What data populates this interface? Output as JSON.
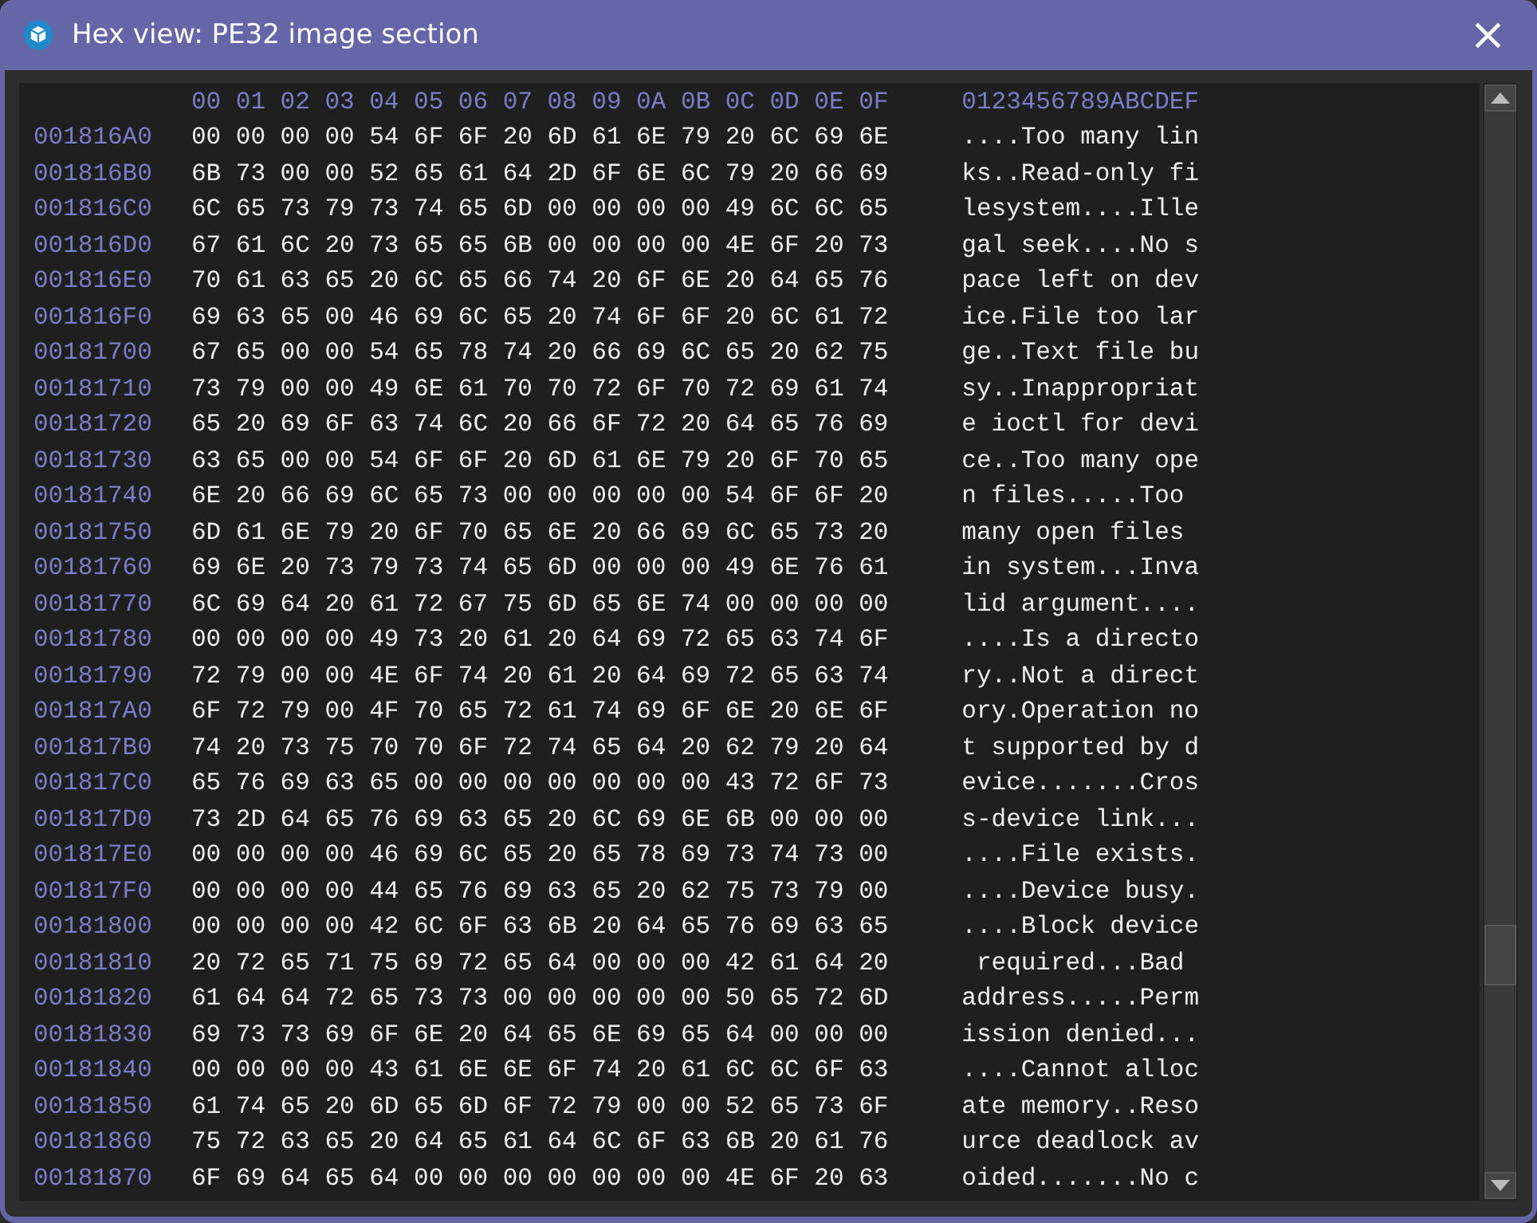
{
  "window": {
    "title": "Hex view: PE32 image section",
    "close": "×"
  },
  "header": {
    "offsets": "00 01 02 03 04 05 06 07 08 09 0A 0B 0C 0D 0E 0F",
    "ascii": "0123456789ABCDEF"
  },
  "rows": [
    {
      "address": "001816A0",
      "bytes": "00 00 00 00 54 6F 6F 20 6D 61 6E 79 20 6C 69 6E",
      "ascii": "....Too many lin"
    },
    {
      "address": "001816B0",
      "bytes": "6B 73 00 00 52 65 61 64 2D 6F 6E 6C 79 20 66 69",
      "ascii": "ks..Read-only fi"
    },
    {
      "address": "001816C0",
      "bytes": "6C 65 73 79 73 74 65 6D 00 00 00 00 49 6C 6C 65",
      "ascii": "lesystem....Ille"
    },
    {
      "address": "001816D0",
      "bytes": "67 61 6C 20 73 65 65 6B 00 00 00 00 4E 6F 20 73",
      "ascii": "gal seek....No s"
    },
    {
      "address": "001816E0",
      "bytes": "70 61 63 65 20 6C 65 66 74 20 6F 6E 20 64 65 76",
      "ascii": "pace left on dev"
    },
    {
      "address": "001816F0",
      "bytes": "69 63 65 00 46 69 6C 65 20 74 6F 6F 20 6C 61 72",
      "ascii": "ice.File too lar"
    },
    {
      "address": "00181700",
      "bytes": "67 65 00 00 54 65 78 74 20 66 69 6C 65 20 62 75",
      "ascii": "ge..Text file bu"
    },
    {
      "address": "00181710",
      "bytes": "73 79 00 00 49 6E 61 70 70 72 6F 70 72 69 61 74",
      "ascii": "sy..Inappropriat"
    },
    {
      "address": "00181720",
      "bytes": "65 20 69 6F 63 74 6C 20 66 6F 72 20 64 65 76 69",
      "ascii": "e ioctl for devi"
    },
    {
      "address": "00181730",
      "bytes": "63 65 00 00 54 6F 6F 20 6D 61 6E 79 20 6F 70 65",
      "ascii": "ce..Too many ope"
    },
    {
      "address": "00181740",
      "bytes": "6E 20 66 69 6C 65 73 00 00 00 00 00 54 6F 6F 20",
      "ascii": "n files.....Too "
    },
    {
      "address": "00181750",
      "bytes": "6D 61 6E 79 20 6F 70 65 6E 20 66 69 6C 65 73 20",
      "ascii": "many open files "
    },
    {
      "address": "00181760",
      "bytes": "69 6E 20 73 79 73 74 65 6D 00 00 00 49 6E 76 61",
      "ascii": "in system...Inva"
    },
    {
      "address": "00181770",
      "bytes": "6C 69 64 20 61 72 67 75 6D 65 6E 74 00 00 00 00",
      "ascii": "lid argument...."
    },
    {
      "address": "00181780",
      "bytes": "00 00 00 00 49 73 20 61 20 64 69 72 65 63 74 6F",
      "ascii": "....Is a directo"
    },
    {
      "address": "00181790",
      "bytes": "72 79 00 00 4E 6F 74 20 61 20 64 69 72 65 63 74",
      "ascii": "ry..Not a direct"
    },
    {
      "address": "001817A0",
      "bytes": "6F 72 79 00 4F 70 65 72 61 74 69 6F 6E 20 6E 6F",
      "ascii": "ory.Operation no"
    },
    {
      "address": "001817B0",
      "bytes": "74 20 73 75 70 70 6F 72 74 65 64 20 62 79 20 64",
      "ascii": "t supported by d"
    },
    {
      "address": "001817C0",
      "bytes": "65 76 69 63 65 00 00 00 00 00 00 00 43 72 6F 73",
      "ascii": "evice.......Cros"
    },
    {
      "address": "001817D0",
      "bytes": "73 2D 64 65 76 69 63 65 20 6C 69 6E 6B 00 00 00",
      "ascii": "s-device link..."
    },
    {
      "address": "001817E0",
      "bytes": "00 00 00 00 46 69 6C 65 20 65 78 69 73 74 73 00",
      "ascii": "....File exists."
    },
    {
      "address": "001817F0",
      "bytes": "00 00 00 00 44 65 76 69 63 65 20 62 75 73 79 00",
      "ascii": "....Device busy."
    },
    {
      "address": "00181800",
      "bytes": "00 00 00 00 42 6C 6F 63 6B 20 64 65 76 69 63 65",
      "ascii": "....Block device"
    },
    {
      "address": "00181810",
      "bytes": "20 72 65 71 75 69 72 65 64 00 00 00 42 61 64 20",
      "ascii": " required...Bad "
    },
    {
      "address": "00181820",
      "bytes": "61 64 64 72 65 73 73 00 00 00 00 00 50 65 72 6D",
      "ascii": "address.....Perm"
    },
    {
      "address": "00181830",
      "bytes": "69 73 73 69 6F 6E 20 64 65 6E 69 65 64 00 00 00",
      "ascii": "ission denied..."
    },
    {
      "address": "00181840",
      "bytes": "00 00 00 00 43 61 6E 6E 6F 74 20 61 6C 6C 6F 63",
      "ascii": "....Cannot alloc"
    },
    {
      "address": "00181850",
      "bytes": "61 74 65 20 6D 65 6D 6F 72 79 00 00 52 65 73 6F",
      "ascii": "ate memory..Reso"
    },
    {
      "address": "00181860",
      "bytes": "75 72 63 65 20 64 65 61 64 6C 6F 63 6B 20 61 76",
      "ascii": "urce deadlock av"
    },
    {
      "address": "00181870",
      "bytes": "6F 69 64 65 64 00 00 00 00 00 00 00 4E 6F 20 63",
      "ascii": "oided.......No c"
    }
  ]
}
